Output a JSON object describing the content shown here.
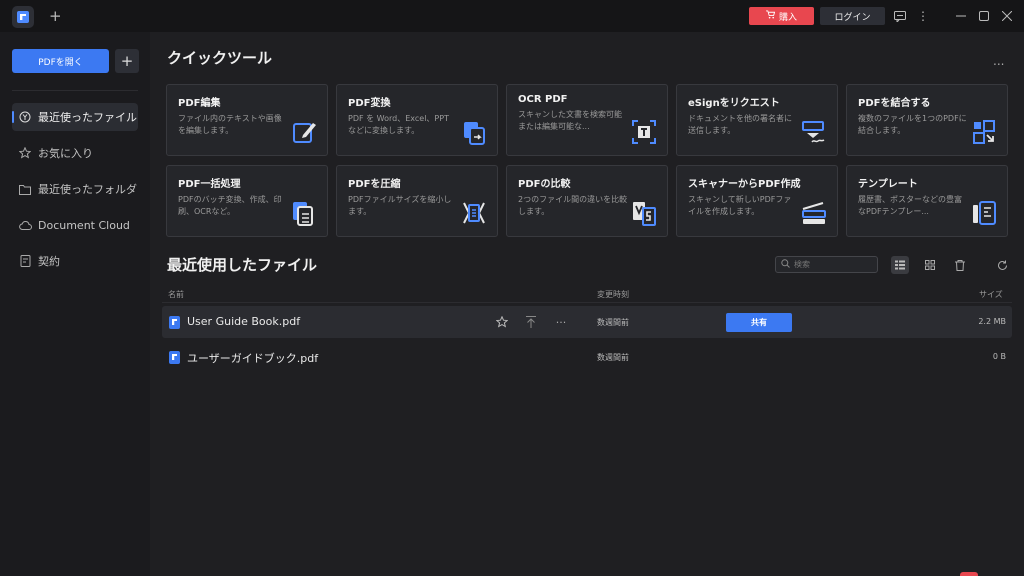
{
  "titlebar": {
    "new_tab": "+",
    "buy_label": "購入",
    "login_label": "ログイン"
  },
  "sidebar": {
    "open_button": "PDFを開く",
    "add_button": "+",
    "items": [
      {
        "label": "最近使ったファイル",
        "icon": "clock-icon",
        "active": true
      },
      {
        "label": "お気に入り",
        "icon": "star-icon",
        "active": false
      },
      {
        "label": "最近使ったフォルダ",
        "icon": "folder-icon",
        "active": false
      },
      {
        "label": "Document Cloud",
        "icon": "cloud-icon",
        "active": false
      },
      {
        "label": "契約",
        "icon": "contract-icon",
        "active": false
      }
    ]
  },
  "quick_tools": {
    "title": "クイックツール",
    "more": "...",
    "cards": [
      {
        "title": "PDF編集",
        "desc": "ファイル内のテキストや画像を編集します。",
        "icon": "edit-icon"
      },
      {
        "title": "PDF変換",
        "desc": "PDF を Word、Excel、PPT などに変換します。",
        "icon": "convert-icon"
      },
      {
        "title": "OCR PDF",
        "desc": "スキャンした文書を検索可能または編集可能な...",
        "icon": "ocr-icon"
      },
      {
        "title": "eSignをリクエスト",
        "desc": "ドキュメントを他の署名者に送信します。",
        "icon": "esign-icon"
      },
      {
        "title": "PDFを結合する",
        "desc": "複数のファイルを1つのPDFに結合します。",
        "icon": "combine-icon"
      },
      {
        "title": "PDF一括処理",
        "desc": "PDFのバッチ変換、作成、印刷、OCRなど。",
        "icon": "batch-icon"
      },
      {
        "title": "PDFを圧縮",
        "desc": "PDFファイルサイズを縮小します。",
        "icon": "compress-icon"
      },
      {
        "title": "PDFの比較",
        "desc": "2つのファイル間の違いを比較します。",
        "icon": "compare-icon"
      },
      {
        "title": "スキャナーからPDF作成",
        "desc": "スキャンして新しいPDFファイルを作成します。",
        "icon": "scanner-icon"
      },
      {
        "title": "テンプレート",
        "desc": "履歴書、ポスターなどの豊富なPDFテンプレー...",
        "icon": "template-icon"
      }
    ]
  },
  "recent": {
    "title": "最近使用したファイル",
    "search_placeholder": "検索",
    "columns": {
      "name": "名前",
      "modified": "変更時刻",
      "size": "サイズ"
    },
    "share_label": "共有",
    "files": [
      {
        "name": "User Guide Book.pdf",
        "modified": "数週間前",
        "size": "2.2 MB"
      },
      {
        "name": "ユーザーガイドブック.pdf",
        "modified": "数週間前",
        "size": "0 B"
      }
    ]
  },
  "colors": {
    "accent": "#3c79f2",
    "buy": "#e8474f",
    "background": "#1f1f22",
    "sidebar": "#1b1b1e"
  }
}
